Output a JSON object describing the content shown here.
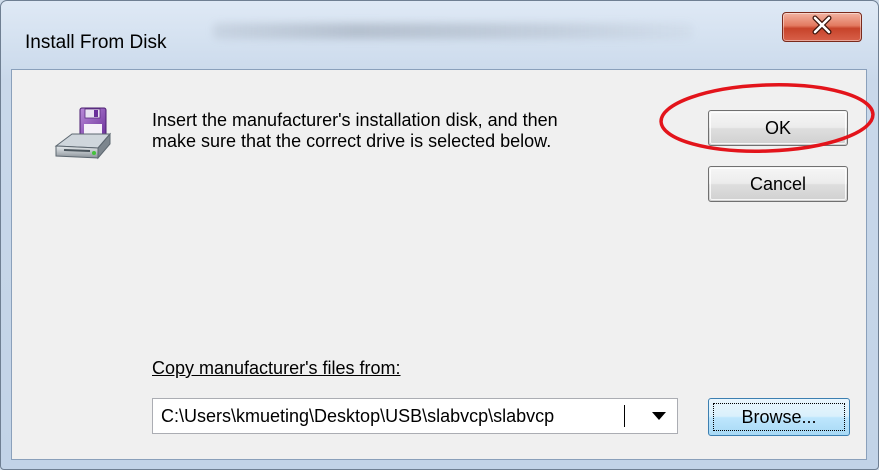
{
  "window": {
    "title": "Install From Disk",
    "close_glyph": "X"
  },
  "dialog": {
    "message_line1": "Insert the manufacturer's installation disk, and then",
    "message_line2": "make sure that the correct drive is selected below.",
    "ok_label": "OK",
    "cancel_label": "Cancel",
    "copy_label": "Copy manufacturer's files from:",
    "path_value": "C:\\Users\\kmueting\\Desktop\\USB\\slabvcp\\slabvcp",
    "browse_label": "Browse..."
  },
  "icons": {
    "disk": "floppy-disk-drive-icon",
    "dropdown": "chevron-down-icon",
    "close": "close-icon"
  },
  "annotation": {
    "highlight_color": "#e3141b"
  }
}
